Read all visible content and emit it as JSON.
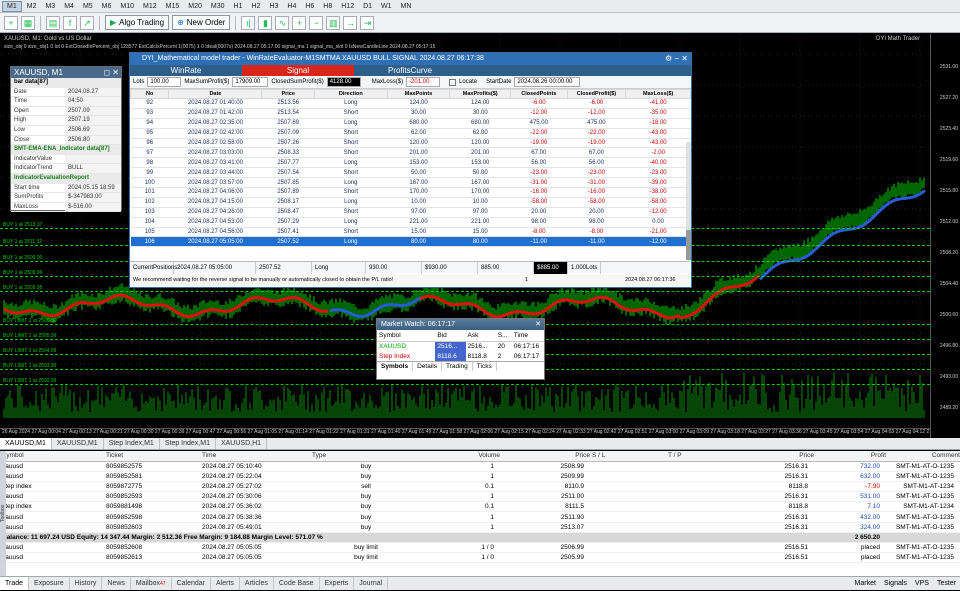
{
  "timeframes": [
    "M1",
    "M2",
    "M3",
    "M4",
    "M5",
    "M6",
    "M10",
    "M12",
    "M15",
    "M20",
    "M30",
    "H1",
    "H2",
    "H3",
    "H4",
    "H6",
    "H8",
    "H12",
    "D1",
    "W1",
    "MN"
  ],
  "toolbar": {
    "algo_label": "Algo Trading",
    "new_order_label": "New Order"
  },
  "chart": {
    "title": "XAUUSD, M1:  Gold vs US Dollar",
    "subtitle": "size_obj 0 size_obj1 0 lot 0 ExtClosedInPercent_obj 123577 ExtCalcIsPercent 1(0075) 1 0 Ideal(0007s) 2024.08.27 05:17:00 signal_ma 1 signal_ma_slot 0 IsNewCandleLine 2024.08.27 05:17:15",
    "brand": "DYI Math Trader",
    "price_labels": [
      "2531.00",
      "2527.20",
      "2523.40",
      "2519.60",
      "2515.80",
      "2512.00",
      "2508.20",
      "2504.40",
      "2500.60",
      "2496.80",
      "2493.00",
      "2489.20"
    ],
    "time_labels": "26 Aug 2024  27 Aug 00:04  27 Aug 00:13  27 Aug 00:21  27 Aug 00:30  27 Aug 00:39  27 Aug 00:47  27 Aug 00:56  27 Aug 01:05  27 Aug 01:14  27 Aug 01:22  27 Aug 01:31  27 Aug 01:40  27 Aug 01:49  27 Aug 01:58  27 Aug 02:06  27 Aug 02:15  27 Aug 02:24  27 Aug 02:33  27 Aug 02:42  27 Aug 02:51  27 Aug 03:00  27 Aug 03:09  27 Aug 03:18  27 Aug 03:27  27 Aug 03:36  27 Aug 03:45  27 Aug 03:54  27 Aug 04:03  27 Aug 04:12  27 Aug 04:21  27 Aug 04:30  27 Aug 04:39  27 Aug 04:48  27 Aug 04:57  27 Aug 05:06",
    "order_lines": [
      "BUY 1 at 2513.37",
      "BUY 1 at 2511.32",
      "BUY 1 at 2509.00",
      "BUY 1 at 2509.99",
      "BUY 1 at 2509.95",
      "BUY LIMIT 1 at 2506.99",
      "BUY LIMIT 1 at 2505.99",
      "BUY LIMIT 1 at 2504.99",
      "BUY LIMIT 1 at 2503.99",
      "BUY LIMIT 1 at 2502.99"
    ]
  },
  "data_window": {
    "title": "XAUUSD, M1",
    "bar_head": "bar data[87]",
    "bar": [
      [
        "Date",
        "2024.08.27"
      ],
      [
        "Time",
        "04:50"
      ],
      [
        "Open",
        "2507.09"
      ],
      [
        "High",
        "2507.19"
      ],
      [
        "Low",
        "2506.69"
      ],
      [
        "Close",
        "2506.80"
      ]
    ],
    "ind_head": "SMT-EMA-ENA_Indicator data[87]",
    "ind": [
      [
        "IndicatorValue",
        ""
      ],
      [
        "IndicatorTrend",
        "BULL"
      ]
    ],
    "eval_head": "IndicatorEvaluationReport",
    "eval": [
      [
        "Start time",
        "2024.05.15 18:59"
      ],
      [
        "SumProfits",
        "$-347983.00"
      ],
      [
        "MaxLoss",
        "$-516.00"
      ]
    ]
  },
  "model_window": {
    "title": "DYI_Mathematical model trader - WinRateEvaluator-M1SMTMA XAUUSD BULL SIGNAL 2024.08.27 06:17:38",
    "tabs": [
      "WinRate",
      "Signal",
      "ProfitsCurve"
    ],
    "form": {
      "lots_label": "Lots",
      "lots": "100.00",
      "maxsum_label": "MaxSumProfit($)",
      "maxsum": "17909.00",
      "closed_label": "ClosedSumProfit($)",
      "closed": "4128.00",
      "maxloss_label": "MaxLoss($)",
      "maxloss": "-201.00",
      "locate_label": "Locate",
      "startdate_label": "StartDate",
      "startdate": "2024.08.26 00:00:00"
    },
    "columns": [
      "No",
      "Date",
      "Price",
      "Direction",
      "MaxPoints",
      "MaxProfits($)",
      "ClosedPoints",
      "ClosedProfit($)",
      "MaxLoss($)"
    ],
    "rows": [
      [
        "92",
        "2024.08.27 01:40:00",
        "2513.56",
        "Long",
        "124.00",
        "124.00",
        "-6.00",
        "-6.00",
        "-41.00"
      ],
      [
        "93",
        "2024.08.27 01:42:00",
        "2513.54",
        "Short",
        "30.00",
        "30.00",
        "-12.00",
        "-12.00",
        "-35.00"
      ],
      [
        "94",
        "2024.08.27 02:35:00",
        "2507.69",
        "Long",
        "680.00",
        "680.00",
        "475.00",
        "475.00",
        "-18.00"
      ],
      [
        "95",
        "2024.08.27 02:42:00",
        "2507.09",
        "Short",
        "62.00",
        "62.00",
        "-22.00",
        "-22.00",
        "-43.00"
      ],
      [
        "96",
        "2024.08.27 02:58:00",
        "2507.26",
        "Short",
        "120.00",
        "120.00",
        "-19.00",
        "-19.00",
        "-43.00"
      ],
      [
        "97",
        "2024.08.27 03:03:00",
        "2508.33",
        "Short",
        "201.00",
        "201.00",
        "67.00",
        "67.00",
        "-2.00"
      ],
      [
        "98",
        "2024.08.27 03:41:00",
        "2507.77",
        "Long",
        "153.00",
        "153.00",
        "56.00",
        "56.00",
        "-40.00"
      ],
      [
        "99",
        "2024.08.27 03:44:00",
        "2507.54",
        "Short",
        "50.00",
        "50.00",
        "-23.00",
        "-23.00",
        "-23.00"
      ],
      [
        "100",
        "2024.08.27 03:57:00",
        "2507.85",
        "Long",
        "167.00",
        "167.00",
        "-31.00",
        "-31.00",
        "-39.00"
      ],
      [
        "101",
        "2024.08.27 04:06:00",
        "2507.89",
        "Short",
        "170.00",
        "170.00",
        "-16.00",
        "-16.00",
        "-38.00"
      ],
      [
        "102",
        "2024.08.27 04:15:00",
        "2508.17",
        "Long",
        "10.00",
        "10.00",
        "-58.00",
        "-58.00",
        "-58.00"
      ],
      [
        "103",
        "2024.08.27 04:26:00",
        "2508.47",
        "Short",
        "97.00",
        "97.00",
        "20.00",
        "20.00",
        "-12.00"
      ],
      [
        "104",
        "2024.08.27 04:53:00",
        "2507.29",
        "Long",
        "221.00",
        "221.00",
        "98.00",
        "98.00",
        "0.00"
      ],
      [
        "105",
        "2024.08.27 04:56:00",
        "2507.41",
        "Short",
        "15.00",
        "15.00",
        "-8.00",
        "-8.00",
        "-21.00"
      ],
      [
        "106",
        "2024.08.27 05:05:00",
        "2507.52",
        "Long",
        "80.00",
        "80.00",
        "-11.00",
        "-11.00",
        "-12.00"
      ]
    ],
    "footer": {
      "label": "CurrentPositions:",
      "date": "2024.08.27 05:05:00",
      "price": "2507.52",
      "dir": "Long",
      "a": "930.00",
      "b": "$930.00",
      "c": "885.00",
      "d": "$885.00",
      "lots": "1.000Lots"
    },
    "status": {
      "msg": "We recommend waiting for the reverse signal to be manually or automatically closed to obtain the P/L ratio!",
      "count": "1",
      "time": "2024.08.27 06:17:36"
    }
  },
  "market_watch": {
    "title": "Market Watch: 06:17:17",
    "columns": [
      "Symbol",
      "Bid",
      "Ask",
      "S...",
      "Time"
    ],
    "rows": [
      [
        "XAUUSD",
        "2516...",
        "2516...",
        "20",
        "06:17:16"
      ],
      [
        "Step Index",
        "8118.6",
        "8118.8",
        "2",
        "06:17:17"
      ]
    ],
    "tabs": [
      "Symbols",
      "Details",
      "Trading",
      "Ticks"
    ]
  },
  "chart_tabs": [
    "XAUUSD,M1",
    "XAUUSD,M1",
    "Step Index,M1",
    "Step Index,M1",
    "XAUUSD,H1"
  ],
  "terminal": {
    "columns": [
      "Symbol",
      "Ticket",
      "Time",
      "Type",
      "Volume",
      "Price",
      "S / L",
      "T / P",
      "Price",
      "Profit",
      "Comment"
    ],
    "rows": [
      [
        "xauusd",
        "8059852575",
        "2024.08.27 05:10:40",
        "buy",
        "1",
        "2508.99",
        "",
        "",
        "2516.31",
        "732.00",
        "SMT-M1-AT-O-1235"
      ],
      [
        "xauusd",
        "8059852581",
        "2024.08.27 05:22:04",
        "buy",
        "1",
        "2509.99",
        "",
        "",
        "2516.31",
        "632.00",
        "SMT-M1-AT-O-1235"
      ],
      [
        "step index",
        "8059872775",
        "2024.08.27 05:27:02",
        "sell",
        "0.1",
        "8110.9",
        "",
        "",
        "8118.8",
        "-7.90",
        "SMT-M1-AT-1234"
      ],
      [
        "xauusd",
        "8059852593",
        "2024.08.27 05:30:06",
        "buy",
        "1",
        "2511.00",
        "",
        "",
        "2516.31",
        "531.00",
        "SMT-M1-AT-O-1235"
      ],
      [
        "step index",
        "8059881498",
        "2024.08.27 05:36:02",
        "buy",
        "0.1",
        "8111.5",
        "",
        "",
        "8118.8",
        "7.10",
        "SMT-M1-AT-1234"
      ],
      [
        "xauusd",
        "8059852598",
        "2024.08.27 05:38:36",
        "buy",
        "1",
        "2511.90",
        "",
        "",
        "2516.31",
        "432.00",
        "SMT-M1-AT-O-1235"
      ],
      [
        "xauusd",
        "8059852603",
        "2024.08.27 05:49:01",
        "buy",
        "1",
        "2513.07",
        "",
        "",
        "2516.31",
        "324.00",
        "SMT-M1-AT-O-1235"
      ]
    ],
    "balance": "Balance: 11 697.24 USD  Equity: 14 347.44  Margin: 2 512.36  Free Margin: 9 184.88  Margin Level: 571.07 %",
    "balance_profit": "2 650.20",
    "pending": [
      [
        "xauusd",
        "8059852608",
        "2024.08.27 05:05:05",
        "buy limit",
        "1 / 0",
        "2506.99",
        "",
        "",
        "2516.51",
        "placed",
        "SMT-M1-AT-O-1235"
      ],
      [
        "xauusd",
        "8059852613",
        "2024.08.27 05:05:05",
        "buy limit",
        "1 / 0",
        "2505.99",
        "",
        "",
        "2516.51",
        "placed",
        "SMT-M1-AT-O-1235"
      ]
    ]
  },
  "bottom_tabs": [
    "Trade",
    "Exposure",
    "History",
    "News",
    "Mailbox",
    "Calendar",
    "Alerts",
    "Articles",
    "Code Base",
    "Experts",
    "Journal"
  ],
  "mailbox_badge": "47",
  "bottom_right": [
    "Market",
    "Signals",
    "VPS",
    "Tester"
  ],
  "side_label": "Toolbox"
}
